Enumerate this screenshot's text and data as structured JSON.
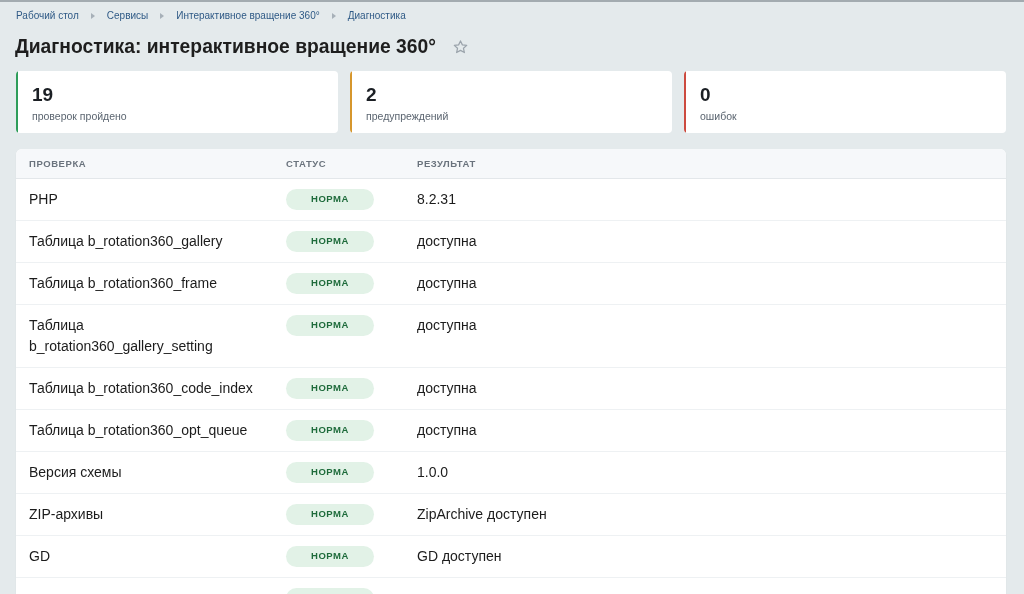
{
  "breadcrumbs": [
    {
      "label": "Рабочий стол"
    },
    {
      "label": "Сервисы"
    },
    {
      "label": "Интерактивное вращение 360°"
    },
    {
      "label": "Диагностика"
    }
  ],
  "title": "Диагностика: интерактивное вращение 360°",
  "favorite": false,
  "summary_cards": [
    {
      "value": "19",
      "label": "проверок пройдено",
      "color": "#2e9d5a"
    },
    {
      "value": "2",
      "label": "предупреждений",
      "color": "#d6962c"
    },
    {
      "value": "0",
      "label": "ошибок",
      "color": "#cc4a3f"
    }
  ],
  "table": {
    "columns": [
      "ПРОВЕРКА",
      "СТАТУС",
      "РЕЗУЛЬТАТ"
    ],
    "rows": [
      {
        "check": "PHP",
        "status": {
          "kind": "ok",
          "label": "НОРМА"
        },
        "result": "8.2.31"
      },
      {
        "check": "Таблица b_rotation360_gallery",
        "status": {
          "kind": "ok",
          "label": "НОРМА"
        },
        "result": "доступна"
      },
      {
        "check": "Таблица b_rotation360_frame",
        "status": {
          "kind": "ok",
          "label": "НОРМА"
        },
        "result": "доступна"
      },
      {
        "check": "Таблица b_rotation360_gallery_setting",
        "status": {
          "kind": "ok",
          "label": "НОРМА"
        },
        "result": "доступна"
      },
      {
        "check": "Таблица b_rotation360_code_index",
        "status": {
          "kind": "ok",
          "label": "НОРМА"
        },
        "result": "доступна"
      },
      {
        "check": "Таблица b_rotation360_opt_queue",
        "status": {
          "kind": "ok",
          "label": "НОРМА"
        },
        "result": "доступна"
      },
      {
        "check": "Версия схемы",
        "status": {
          "kind": "ok",
          "label": "НОРМА"
        },
        "result": "1.0.0"
      },
      {
        "check": "ZIP-архивы",
        "status": {
          "kind": "ok",
          "label": "НОРМА"
        },
        "result": "ZipArchive доступен"
      },
      {
        "check": "GD",
        "status": {
          "kind": "ok",
          "label": "НОРМА"
        },
        "result": "GD доступен"
      },
      {
        "status": {
          "kind": "ok"
        }
      }
    ]
  }
}
